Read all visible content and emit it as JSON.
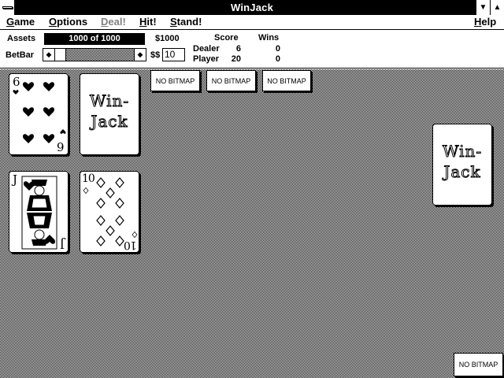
{
  "window": {
    "title": "WinJack",
    "minimize_glyph": "▼",
    "maximize_glyph": "▲"
  },
  "menu": {
    "game": {
      "hot": "G",
      "rest": "ame"
    },
    "options": {
      "hot": "O",
      "rest": "ptions"
    },
    "deal": {
      "hot": "D",
      "rest": "eal!"
    },
    "hit": {
      "hot": "H",
      "rest": "it!"
    },
    "stand": {
      "hot": "S",
      "rest": "tand!"
    },
    "help": {
      "hot": "H",
      "rest": "elp"
    }
  },
  "panel": {
    "assets_label": "Assets",
    "assets_value": "1000 of 1000",
    "bankroll": "$1000",
    "betbar_label": "BetBar",
    "bet_prefix": "$$",
    "bet_value": "10",
    "score_header": "Score",
    "wins_header": "Wins",
    "dealer_label": "Dealer",
    "dealer_score": "6",
    "dealer_wins": "0",
    "player_label": "Player",
    "player_score": "20",
    "player_wins": "0"
  },
  "table": {
    "card_back_line1": "Win-",
    "card_back_line2": "Jack",
    "no_bitmap": "NO BITMAP",
    "dealer_card_1": {
      "rank": "6",
      "suit": "hearts",
      "color": "#000000"
    },
    "player_card_1": {
      "rank": "J",
      "suit": "hearts",
      "color": "#000000"
    },
    "player_card_2": {
      "rank": "10",
      "suit": "diamonds",
      "color": "#000000"
    }
  }
}
